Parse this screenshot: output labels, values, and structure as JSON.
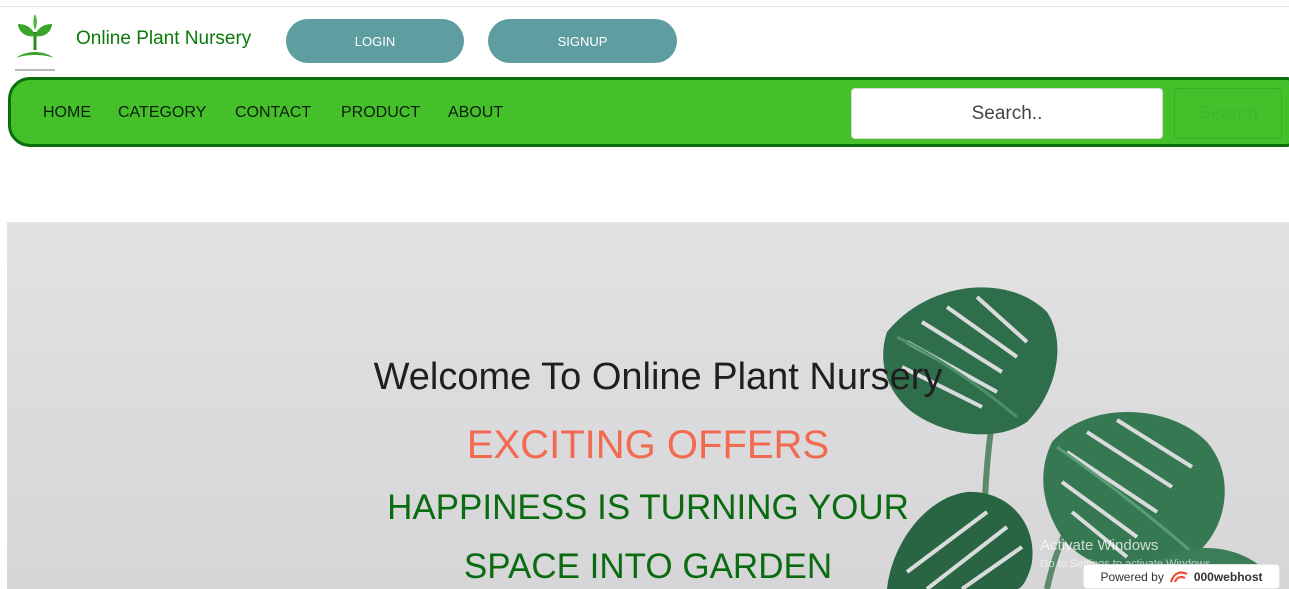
{
  "header": {
    "title": "Online Plant Nursery",
    "login_label": "LOGIN",
    "signup_label": "SIGNUP"
  },
  "nav": {
    "items": [
      "HOME",
      "CATEGORY",
      "CONTACT",
      "PRODUCT",
      "ABOUT"
    ],
    "search_placeholder": "Search..",
    "search_button": "Search"
  },
  "hero": {
    "welcome": "Welcome To Online Plant Nursery",
    "offers": "EXCITING OFFERS",
    "tagline_1": "HAPPINESS IS TURNING YOUR",
    "tagline_2": "SPACE INTO GARDEN"
  },
  "overlay": {
    "watermark_title": "Activate Windows",
    "watermark_sub": "Go to Settings to activate Windows.",
    "powered_by": "Powered by",
    "host_brand": "000webhost"
  },
  "colors": {
    "navbar": "#45c02b",
    "title_green": "#0b7a0b",
    "button": "#5e9ea0",
    "offers": "#f26a4f"
  }
}
